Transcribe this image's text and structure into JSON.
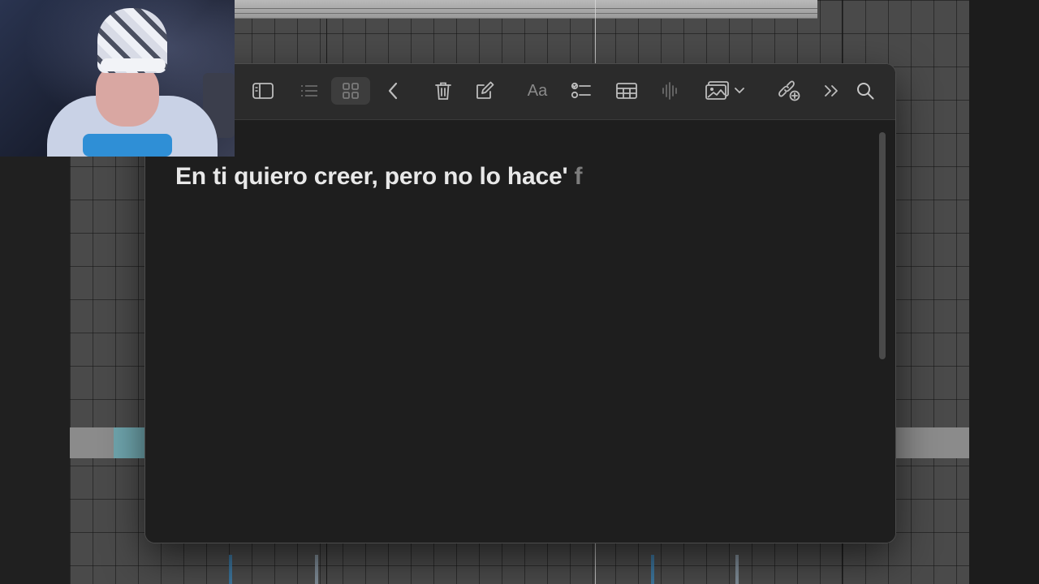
{
  "note": {
    "text_main": "En ti quiero creer, pero no lo hace'",
    "text_faded": " f"
  },
  "toolbar": {
    "font_button_label": "Aa",
    "icons": [
      "sidebar-icon",
      "list-view-icon",
      "gallery-view-icon",
      "back-icon",
      "trash-icon",
      "compose-icon",
      "format-text-icon",
      "checklist-icon",
      "table-icon",
      "audio-icon",
      "media-icon",
      "chevron-down-icon",
      "share-link-icon",
      "more-icon",
      "search-icon"
    ]
  },
  "colors": {
    "window_bg": "#1e1e1e",
    "toolbar_bg": "#2b2b2b",
    "text": "#e8e8e8",
    "text_faded": "#7d7d7d",
    "icon": "#bdbdbd",
    "icon_dim": "#6a6a6a",
    "daw_grid": "#4a4a4a"
  }
}
